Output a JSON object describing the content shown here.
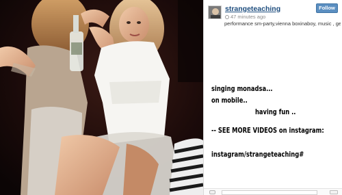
{
  "post": {
    "username": "strangeteaching",
    "time_ago": "47 minutes ago",
    "follow_label": "Follow",
    "caption": "performance sm-party,vienna boxinaboy, music , germany",
    "overlay_lines": [
      "singing monadsa...",
      "on mobile..",
      "having fun ..",
      "-- SEE MORE VIDEOS on instagram:",
      "instagram/strangeteaching#"
    ]
  },
  "footer": {
    "comment_placeholder": ""
  },
  "icons": {
    "clock": "clock-icon",
    "heart": "heart-icon",
    "more": "more-icon"
  },
  "colors": {
    "username": "#1c4c7d",
    "follow_button": "#5b8fc1",
    "photo_background": "#14090a"
  }
}
